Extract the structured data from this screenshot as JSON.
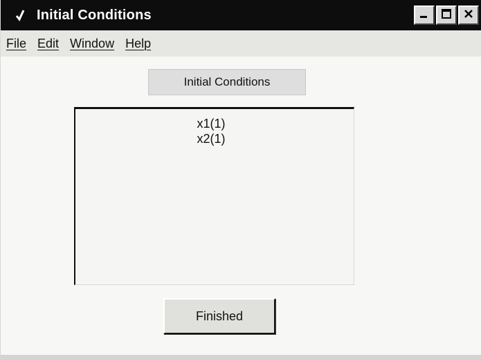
{
  "window": {
    "title": "Initial Conditions",
    "controls": [
      "minimize-icon",
      "maximize-icon",
      "close-icon"
    ]
  },
  "menu": {
    "items": [
      {
        "label": "File"
      },
      {
        "label": "Edit"
      },
      {
        "label": "Window"
      },
      {
        "label": "Help"
      }
    ]
  },
  "main": {
    "heading": "Initial Conditions",
    "list_items": [
      "x1(1)",
      "x2(1)"
    ],
    "finished_label": "Finished"
  },
  "colors": {
    "titlebar": "#0d0d0d",
    "background": "#f7f7f5"
  }
}
